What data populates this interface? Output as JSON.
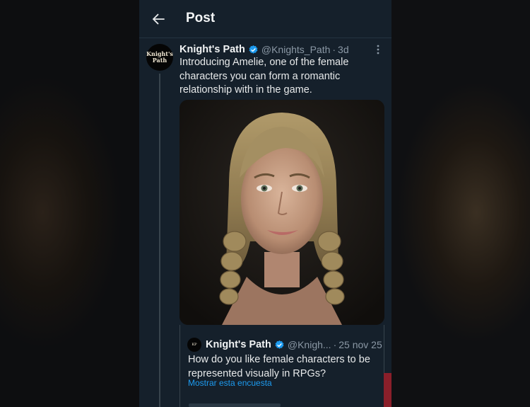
{
  "topbar": {
    "title": "Post"
  },
  "post": {
    "avatar_text": "Knight's Path",
    "author_name": "Knight's Path",
    "handle": "@Knights_Path",
    "separator": "·",
    "time": "3d",
    "text": "Introducing Amelie, one of the female characters you can form a romantic relationship with in the game."
  },
  "quote": {
    "avatar_text": "Knight's Path",
    "author_name": "Knight's Path",
    "handle": "@Knigh...",
    "separator": "·",
    "time": "25 nov 25",
    "text": "How do you like female characters to be represented visually in RPGs?",
    "link": "Mostrar esta encuesta"
  },
  "colors": {
    "background": "#15202b",
    "accent": "#1d9bf0",
    "text": "#e7e9ea",
    "muted": "#8b98a5",
    "border": "#38444d"
  },
  "icons": [
    "arrow-left-icon",
    "verified-badge-icon",
    "more-vertical-icon"
  ]
}
